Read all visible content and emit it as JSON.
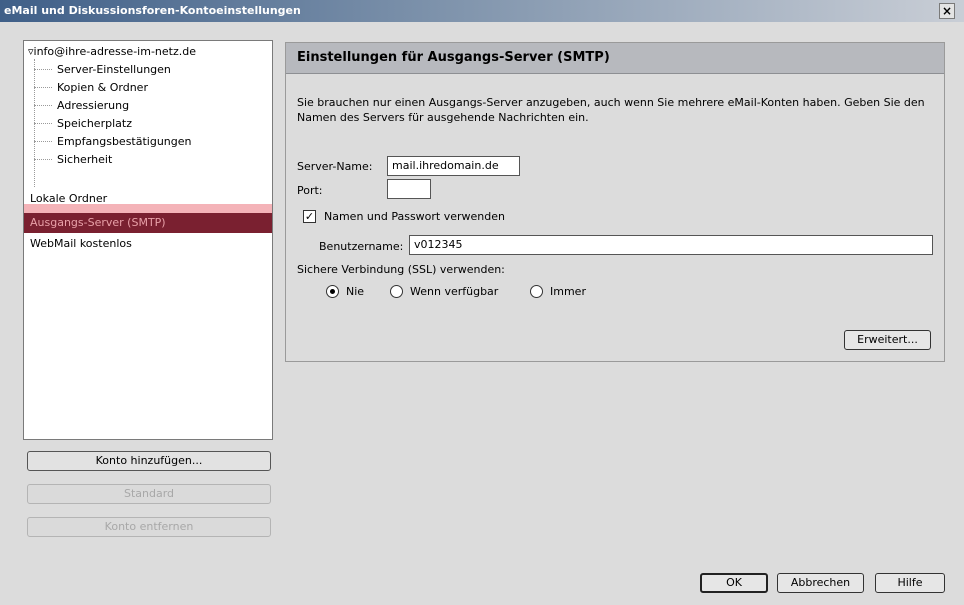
{
  "window": {
    "title": "eMail und Diskussionsforen-Kontoeinstellungen",
    "close_label": "×"
  },
  "tree": {
    "root": "▿info@ihre-adresse-im-netz.de",
    "children": [
      "Server-Einstellungen",
      "Kopien & Ordner",
      "Adressierung",
      "Speicherplatz",
      "Empfangsbestätigungen",
      "Sicherheit"
    ],
    "local_folders": "Lokale Ordner",
    "smtp": "Ausgangs-Server (SMTP)",
    "webmail": "WebMail kostenlos"
  },
  "side_buttons": {
    "add": "Konto hinzufügen...",
    "default": "Standard",
    "remove": "Konto entfernen"
  },
  "panel": {
    "title": "Einstellungen für Ausgangs-Server (SMTP)",
    "description": "Sie brauchen nur einen Ausgangs-Server anzugeben, auch wenn Sie mehrere eMail-Konten haben. Geben Sie den Namen des Servers für ausgehende Nachrichten ein.",
    "server_label": "Server-Name:",
    "server_value": "mail.ihredomain.de",
    "port_label": "Port:",
    "port_value": "",
    "auth_checkbox_label": "Namen und Passwort verwenden",
    "auth_checked": true,
    "check_mark": "✓",
    "username_label": "Benutzername:",
    "username_value": "v012345",
    "ssl_label": "Sichere Verbindung (SSL) verwenden:",
    "ssl_options": [
      "Nie",
      "Wenn verfügbar",
      "Immer"
    ],
    "ssl_selected": "Nie",
    "advanced_button": "Erweitert..."
  },
  "footer": {
    "ok": "OK",
    "cancel": "Abbrechen",
    "help": "Hilfe"
  },
  "colors": {
    "selected_bg": "#7a2030",
    "highlight": "#f2a6ac",
    "titlebar": "#3f5f88"
  }
}
